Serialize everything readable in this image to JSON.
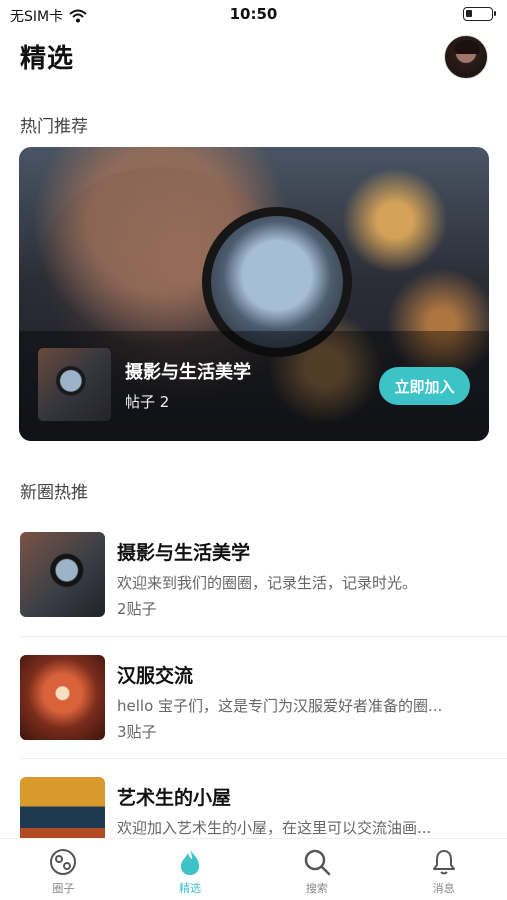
{
  "status_bar": {
    "carrier": "无SIM卡",
    "time": "10:50"
  },
  "header": {
    "title": "精选"
  },
  "hot_section": {
    "title": "热门推荐",
    "card": {
      "name": "摄影与生活美学",
      "posts": "帖子 2",
      "join_label": "立即加入"
    }
  },
  "new_section": {
    "title": "新圈热推",
    "items": [
      {
        "title": "摄影与生活美学",
        "desc": "欢迎来到我们的圈圈，记录生活，记录时光。",
        "count": "2贴子"
      },
      {
        "title": "汉服交流",
        "desc": "hello 宝子们，这是专门为汉服爱好者准备的圈...",
        "count": "3贴子"
      },
      {
        "title": "艺术生的小屋",
        "desc": "欢迎加入艺术生的小屋，在这里可以交流油画...",
        "count": ""
      }
    ]
  },
  "tab_bar": {
    "tabs": [
      {
        "label": "圈子",
        "icon": "circle-icon"
      },
      {
        "label": "精选",
        "icon": "flame-icon"
      },
      {
        "label": "搜索",
        "icon": "search-icon"
      },
      {
        "label": "消息",
        "icon": "bell-icon"
      }
    ],
    "active_color": "#3cc3c8"
  }
}
